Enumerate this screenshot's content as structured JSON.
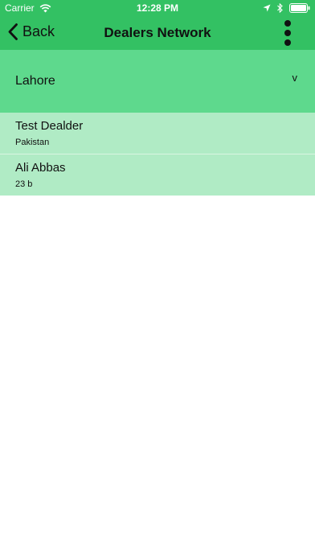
{
  "status_bar": {
    "carrier": "Carrier",
    "time": "12:28 PM",
    "icons": [
      "wifi-icon",
      "location-arrow-icon",
      "bluetooth-icon",
      "battery-icon"
    ]
  },
  "nav": {
    "back_label": "Back",
    "title": "Dealers Network",
    "back_icon": "chevron-left-icon",
    "more_icon": "vertical-dots-icon"
  },
  "city": {
    "selected": "Lahore",
    "chevron": "v"
  },
  "dealers": [
    {
      "name": "Test Dealder",
      "address": "Pakistan"
    },
    {
      "name": "Ali Abbas",
      "address": "23 b"
    }
  ],
  "colors": {
    "header_green": "#33c163",
    "selector_green": "#5ed98d",
    "list_green": "#b0ebc5",
    "background": "#ffffff"
  }
}
